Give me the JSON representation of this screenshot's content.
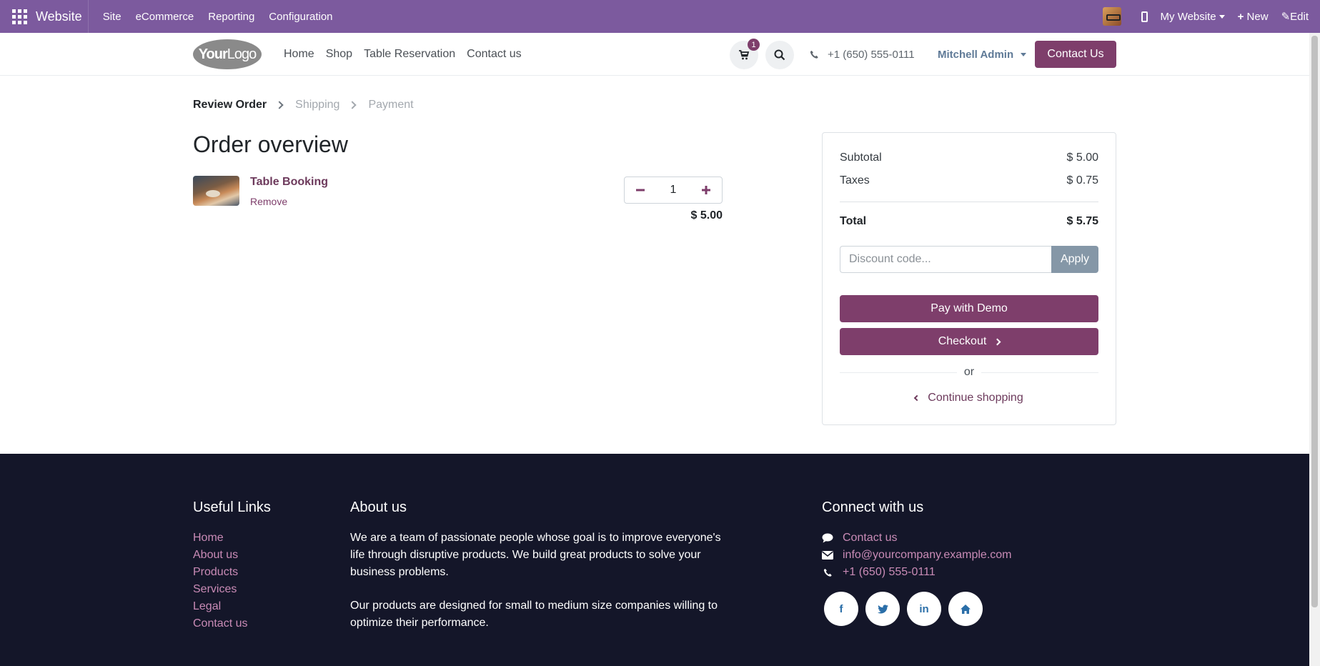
{
  "adminbar": {
    "brand": "Website",
    "menus": [
      "Site",
      "eCommerce",
      "Reporting",
      "Configuration"
    ],
    "website_selector": "My Website",
    "new_label": "New",
    "edit_label": "Edit"
  },
  "header": {
    "logo_bold": "Your",
    "logo_light": "Logo",
    "nav": [
      "Home",
      "Shop",
      "Table Reservation",
      "Contact us"
    ],
    "cart_count": "1",
    "phone": "+1 (650) 555-0111",
    "user": "Mitchell Admin",
    "contact_button": "Contact Us"
  },
  "steps": {
    "active": "Review Order",
    "items": [
      "Shipping",
      "Payment"
    ]
  },
  "order": {
    "title": "Order overview",
    "product_name": "Table Booking",
    "remove_label": "Remove",
    "quantity": "1",
    "line_price": "$ 5.00"
  },
  "summary": {
    "subtotal_label": "Subtotal",
    "subtotal_value": "$ 5.00",
    "taxes_label": "Taxes",
    "taxes_value": "$ 0.75",
    "total_label": "Total",
    "total_value": "$ 5.75",
    "discount_placeholder": "Discount code...",
    "apply_label": "Apply",
    "pay_demo_label": "Pay with Demo",
    "checkout_label": "Checkout",
    "or_label": "or",
    "continue_label": "Continue shopping"
  },
  "footer": {
    "useful_links_title": "Useful Links",
    "useful_links": [
      "Home",
      "About us",
      "Products",
      "Services",
      "Legal",
      "Contact us"
    ],
    "about_title": "About us",
    "about_p1": "We are a team of passionate people whose goal is to improve everyone's life through disruptive products. We build great products to solve your business problems.",
    "about_p2": "Our products are designed for small to medium size companies willing to optimize their performance.",
    "connect_title": "Connect with us",
    "connect_contact": "Contact us",
    "connect_email": "info@yourcompany.example.com",
    "connect_phone": "+1 (650) 555-0111",
    "socials": [
      "facebook-icon",
      "twitter-icon",
      "linkedin-icon",
      "home-icon"
    ]
  },
  "colors": {
    "adminbar": "#7c5a9e",
    "primary": "#7e3e6b",
    "footer_bg": "#141629",
    "footer_link": "#c98bb6"
  }
}
